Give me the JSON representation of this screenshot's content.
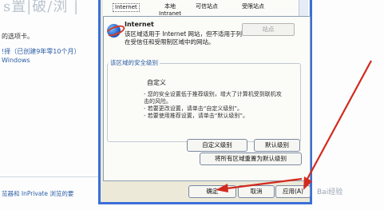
{
  "background_page": {
    "heading_fragment": "s置|破/浏 | ",
    "line1": "的选项卡。",
    "line2": "!择（已创建9年零10个月）",
    "line3": "Windows",
    "line4": "览器和 InPrivate 浏览的要"
  },
  "zones": [
    {
      "label": "Internet",
      "selected": true
    },
    {
      "label": "本地 Intranet",
      "selected": false
    },
    {
      "label": "可信站点",
      "selected": false
    },
    {
      "label": "受限站点",
      "selected": false
    }
  ],
  "zone_info": {
    "title": "Internet",
    "description": "该区域适用于 Internet 网站，但不适用于列在受信任和受限制区域中的网站。",
    "sites_button": "站点"
  },
  "security_level": {
    "group_label": "该区域的安全级别",
    "level_name": "自定义",
    "details": [
      "- 您的安全设置低于推荐级别，增大了计算机受到联机攻击的风险。",
      "- 若要更改设置，请单击“自定义级别”。",
      "- 若要使用推荐设置，请单击“默认级别”。"
    ],
    "custom_level_button": "自定义级别",
    "default_level_button": "默认级别",
    "reset_all_button": "将所有区域重置为默认级别"
  },
  "footer": {
    "ok_button": "确定",
    "cancel_button": "取消",
    "apply_button": "应用(A)"
  },
  "watermark": "Bai经验",
  "colors": {
    "annotation_arrow": "#d22a1e",
    "window_frame": "#3a6fd8",
    "dialog_face": "#ece9d8",
    "link_blue": "#2b5ea7"
  }
}
